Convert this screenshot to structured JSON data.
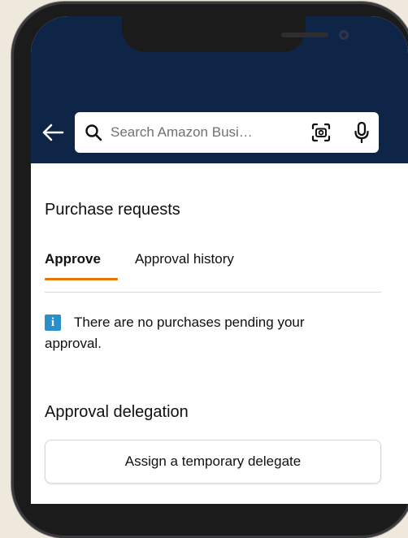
{
  "search": {
    "placeholder": "Search Amazon Busi…"
  },
  "page": {
    "title": "Purchase requests"
  },
  "tabs": [
    {
      "label": "Approve",
      "active": true
    },
    {
      "label": "Approval history",
      "active": false
    }
  ],
  "info": {
    "icon": "info-icon",
    "message": "There are no purchases pending your approval."
  },
  "delegation": {
    "title": "Approval delegation",
    "button_label": "Assign a temporary delegate"
  },
  "icons": {
    "back": "back-arrow-icon",
    "search": "search-icon",
    "camera": "camera-scan-icon",
    "mic": "microphone-icon"
  },
  "colors": {
    "header_bg": "#0f2548",
    "active_tab_underline": "#e77600",
    "info_icon": "#2b8fc9"
  }
}
